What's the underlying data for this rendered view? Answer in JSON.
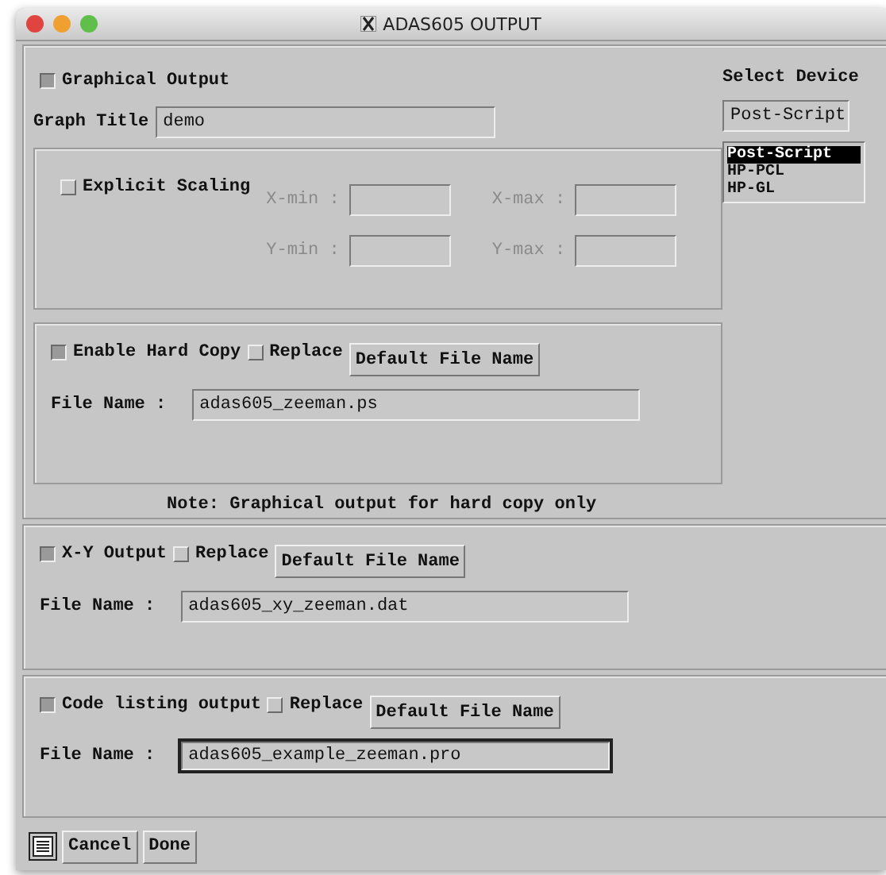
{
  "window": {
    "title": "ADAS605 OUTPUT"
  },
  "graphical": {
    "toggle": {
      "label": "Graphical Output",
      "checked": true
    },
    "graph_title": {
      "label": "Graph Title",
      "value": "demo"
    },
    "scaling": {
      "toggle": {
        "label": "Explicit Scaling",
        "checked": false
      },
      "disabled": true,
      "fields": [
        {
          "label": "X-min :"
        },
        {
          "label": "X-max :"
        },
        {
          "label": "Y-min :"
        },
        {
          "label": "Y-max :"
        }
      ]
    },
    "hard_copy": {
      "toggle": {
        "label": "Enable Hard Copy",
        "checked": true
      },
      "replace": {
        "label": "Replace",
        "checked": false
      },
      "default_button": "Default File Name",
      "file_label": "File Name :",
      "file_value": "adas605_zeeman.ps",
      "focused": false
    },
    "note": "Note: Graphical output for hard copy only",
    "device": {
      "label": "Select Device",
      "value": "Post-Script",
      "options": [
        {
          "label": "Post-Script",
          "selected": true
        },
        {
          "label": "HP-PCL",
          "selected": false
        },
        {
          "label": "HP-GL",
          "selected": false
        }
      ]
    }
  },
  "outputs": [
    {
      "toggle": {
        "label": "X-Y Output",
        "checked": true
      },
      "replace": {
        "label": "Replace",
        "checked": false
      },
      "default_button": "Default File Name",
      "file_label": "File Name :",
      "file_value": "adas605_xy_zeeman.dat",
      "focused": false
    },
    {
      "toggle": {
        "label": "Code listing output",
        "checked": true
      },
      "replace": {
        "label": "Replace",
        "checked": false
      },
      "default_button": "Default File Name",
      "file_label": "File Name :",
      "file_value": "adas605_example_zeeman.pro",
      "focused": true
    }
  ],
  "buttons": [
    "Cancel",
    "Done"
  ]
}
